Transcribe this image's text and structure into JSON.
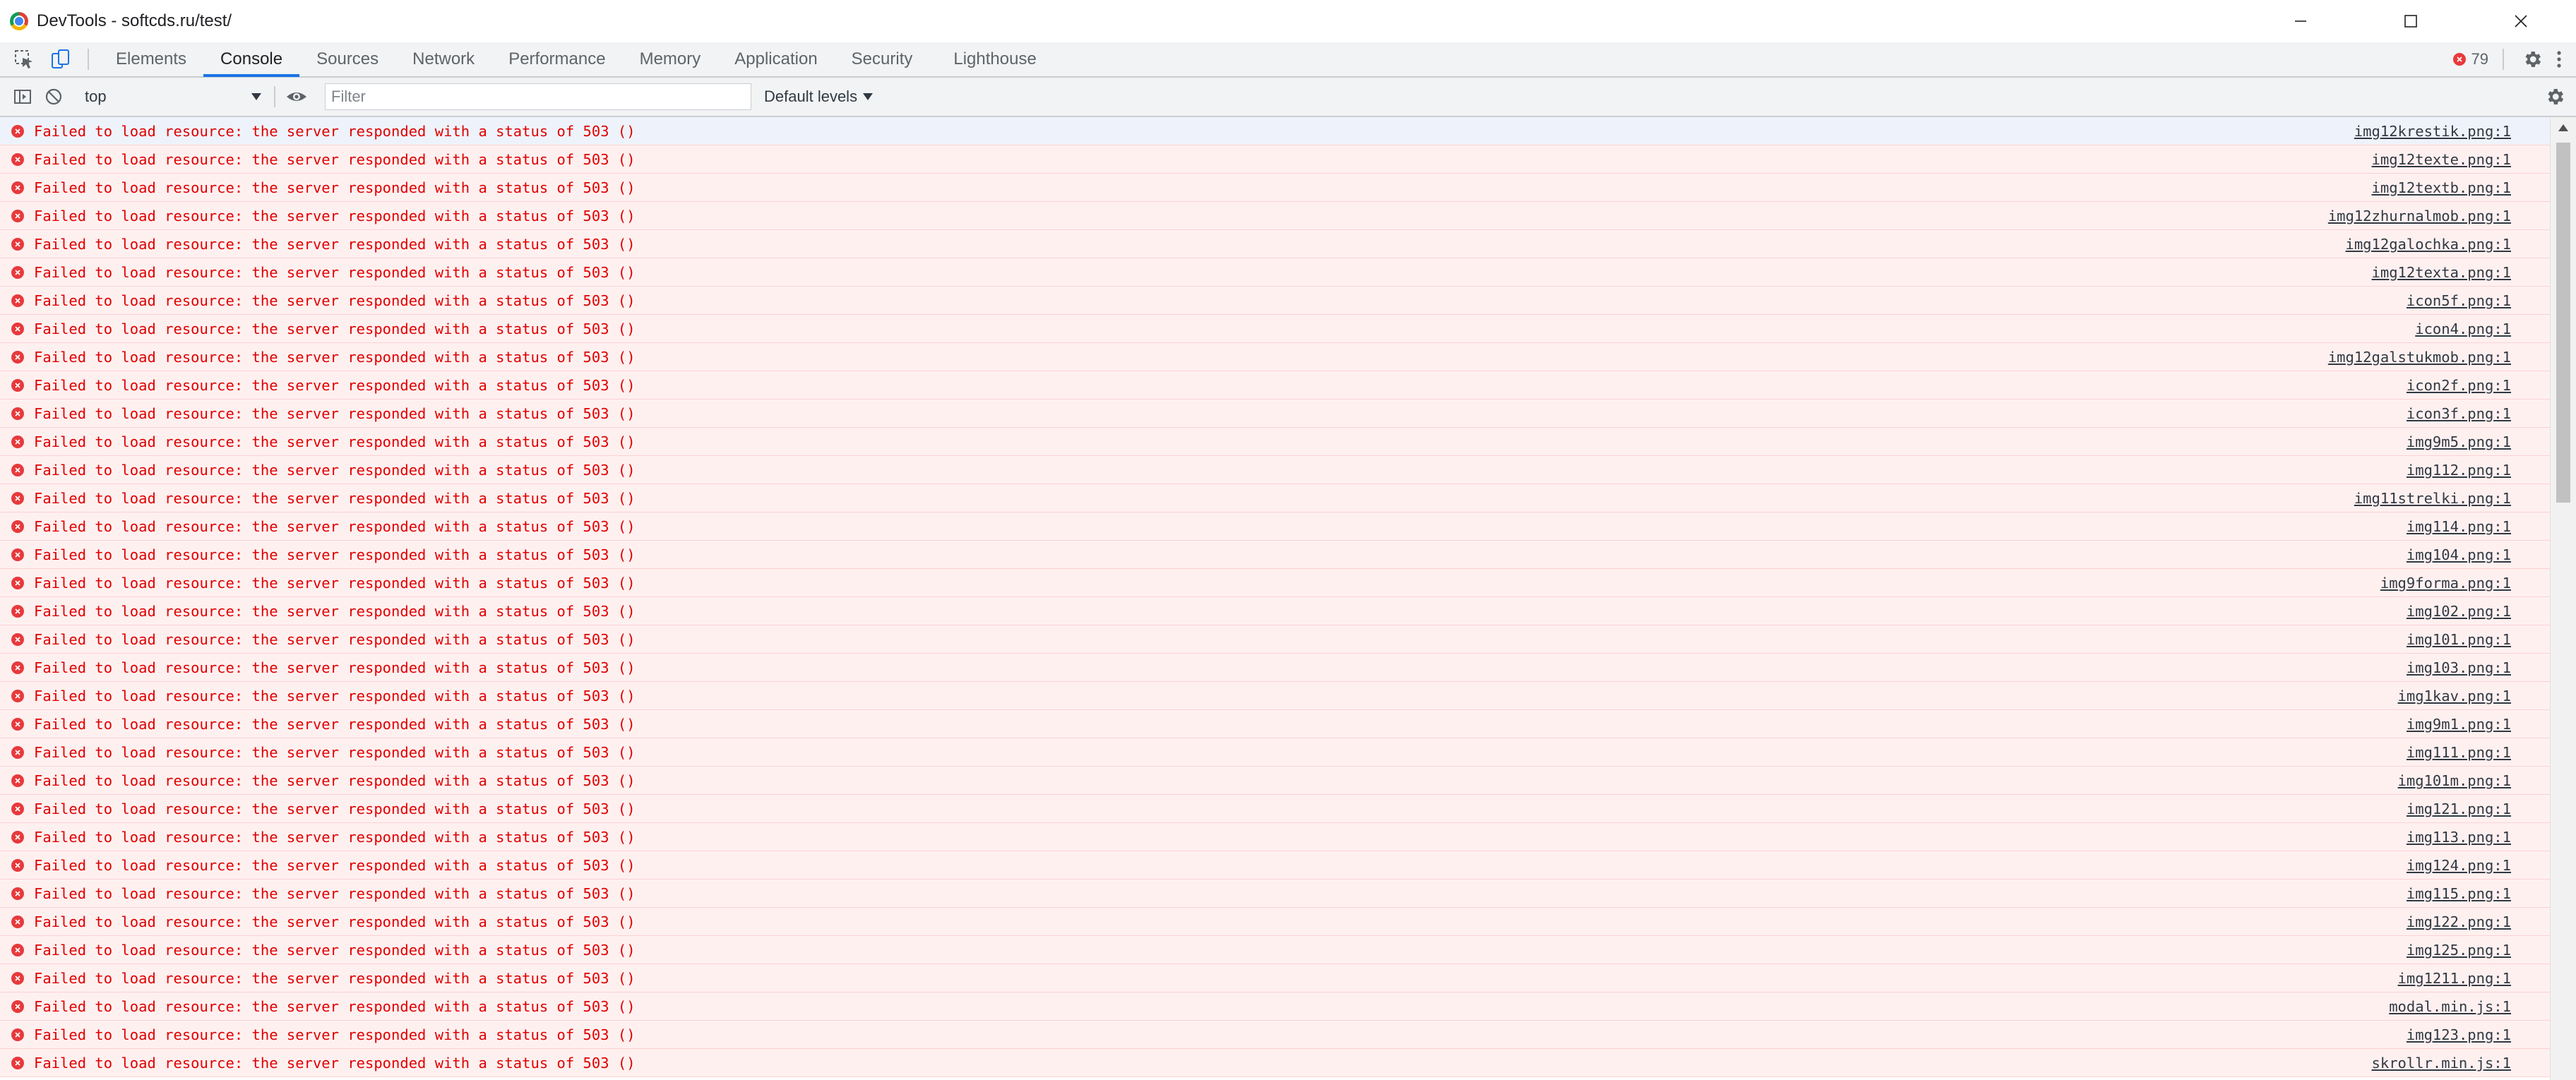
{
  "window": {
    "title": "DevTools - softcds.ru/test/",
    "minimize_label": "Minimize",
    "maximize_label": "Maximize",
    "close_label": "Close"
  },
  "tabs": [
    {
      "label": "Elements"
    },
    {
      "label": "Console"
    },
    {
      "label": "Sources"
    },
    {
      "label": "Network"
    },
    {
      "label": "Performance"
    },
    {
      "label": "Memory"
    },
    {
      "label": "Application"
    },
    {
      "label": "Security"
    },
    {
      "label": "Lighthouse"
    }
  ],
  "active_tab": "Console",
  "error_count": "79",
  "toolbar": {
    "context": "top",
    "filter_placeholder": "Filter",
    "levels_label": "Default levels"
  },
  "colors": {
    "accent": "#1a73e8",
    "error_text": "#e00000",
    "error_bg": "#fff0f0",
    "error_icon": "#e8393c"
  },
  "console": {
    "message": "Failed to load resource: the server responded with a status of 503 ()",
    "sources": [
      "img12krestik.png:1",
      "img12texte.png:1",
      "img12textb.png:1",
      "img12zhurnalmob.png:1",
      "img12galochka.png:1",
      "img12texta.png:1",
      "icon5f.png:1",
      "icon4.png:1",
      "img12galstukmob.png:1",
      "icon2f.png:1",
      "icon3f.png:1",
      "img9m5.png:1",
      "img112.png:1",
      "img11strelki.png:1",
      "img114.png:1",
      "img104.png:1",
      "img9forma.png:1",
      "img102.png:1",
      "img101.png:1",
      "img103.png:1",
      "img1kav.png:1",
      "img9m1.png:1",
      "img111.png:1",
      "img101m.png:1",
      "img121.png:1",
      "img113.png:1",
      "img124.png:1",
      "img115.png:1",
      "img122.png:1",
      "img125.png:1",
      "img1211.png:1",
      "modal.min.js:1",
      "img123.png:1",
      "skrollr.min.js:1"
    ]
  }
}
